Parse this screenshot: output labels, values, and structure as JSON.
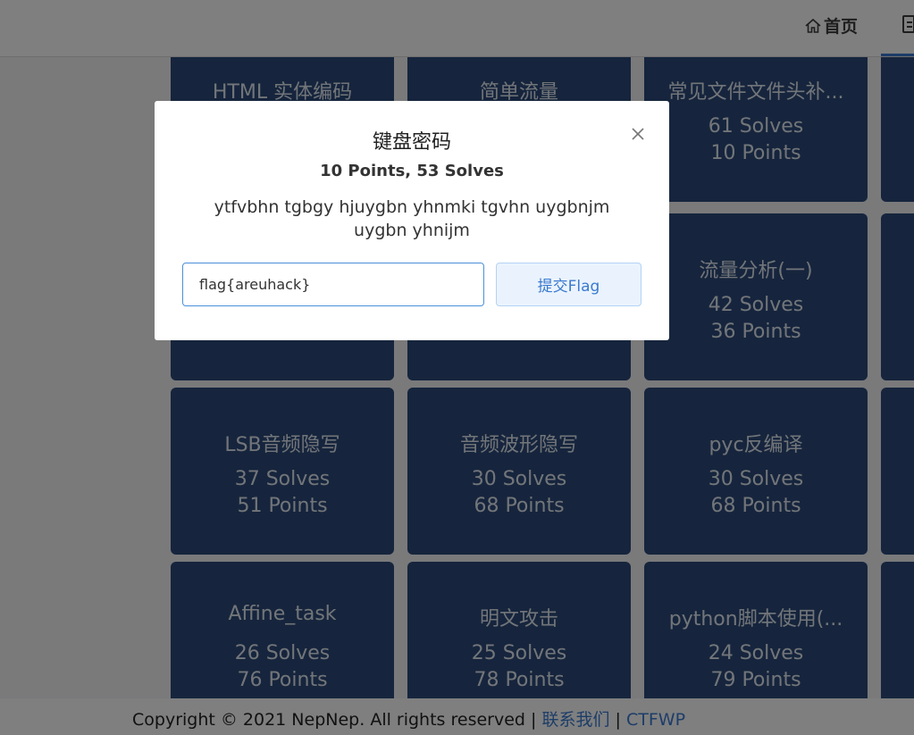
{
  "nav": {
    "home_label": "首页"
  },
  "challenges": [
    {
      "title": "HTML 实体编码",
      "solves": "",
      "points": ""
    },
    {
      "title": "简单流量",
      "solves": "",
      "points": ""
    },
    {
      "title": "常见文件文件头补...",
      "solves": "61 Solves",
      "points": "10 Points"
    },
    {
      "title": "",
      "solves": "",
      "points": ""
    },
    {
      "title": "",
      "solves": "",
      "points": ""
    },
    {
      "title": "流量分析(一)",
      "solves": "42 Solves",
      "points": "36 Points"
    },
    {
      "title": "LSB音频隐写",
      "solves": "37 Solves",
      "points": "51 Points"
    },
    {
      "title": "音频波形隐写",
      "solves": "30 Solves",
      "points": "68 Points"
    },
    {
      "title": "pyc反编译",
      "solves": "30 Solves",
      "points": "68 Points"
    },
    {
      "title": "Affine_task",
      "solves": "26 Solves",
      "points": "76 Points"
    },
    {
      "title": "明文攻击",
      "solves": "25 Solves",
      "points": "78 Points"
    },
    {
      "title": "python脚本使用(...",
      "solves": "24 Solves",
      "points": "79 Points"
    }
  ],
  "modal": {
    "title": "键盘密码",
    "meta": "10 Points, 53 Solves",
    "description": "ytfvbhn tgbgy hjuygbn yhnmki tgvhn uygbnjm uygbn yhnijm",
    "flag_value": "flag{areuhack}",
    "submit_label": "提交Flag"
  },
  "footer": {
    "copyright": "Copyright © 2021 NepNep. All rights reserved |",
    "contact_label": "联系我们",
    "separator": "|",
    "wp_label": "CTFWP"
  },
  "colors": {
    "card_bg": "#2c4a7b",
    "accent": "#3a7ad0",
    "overlay": "rgba(0,0,0,0.5)"
  }
}
